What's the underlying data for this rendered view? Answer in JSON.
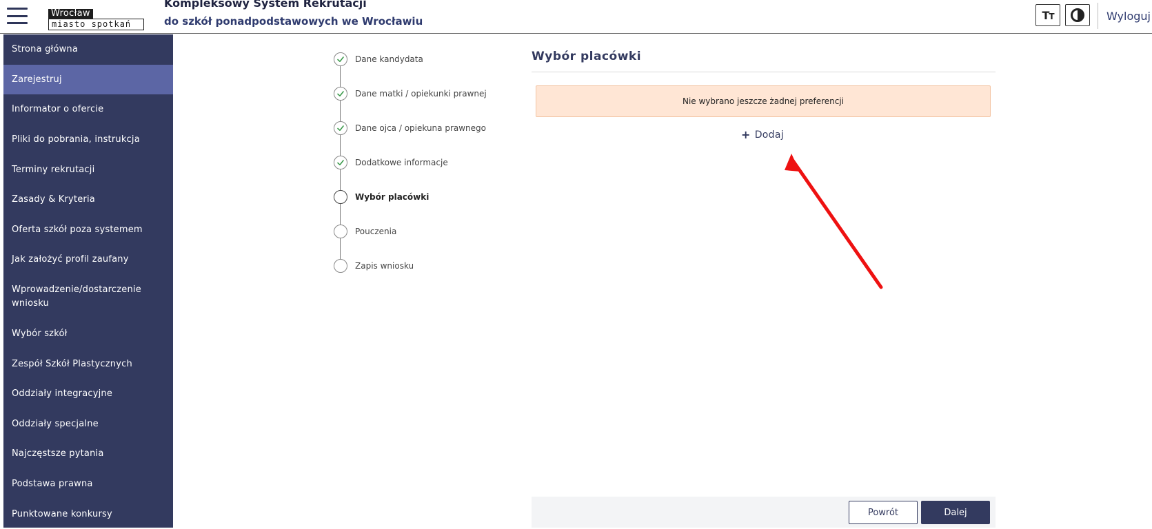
{
  "header": {
    "logo_city": "Wrocław",
    "logo_tagline": "miasto spotkań",
    "title": "Kompleksowy System Rekrutacji",
    "subtitle": "do szkół ponadpodstawowych we Wrocławiu",
    "font_size_icon": "font-size-icon",
    "contrast_icon": "contrast-icon",
    "logout_label": "Wyloguj"
  },
  "sidebar": {
    "items": [
      {
        "label": "Strona główna",
        "active": false
      },
      {
        "label": "Zarejestruj",
        "active": true
      },
      {
        "label": "Informator o ofercie",
        "active": false
      },
      {
        "label": "Pliki do pobrania, instrukcja",
        "active": false
      },
      {
        "label": "Terminy rekrutacji",
        "active": false
      },
      {
        "label": "Zasady & Kryteria",
        "active": false
      },
      {
        "label": "Oferta szkół poza systemem",
        "active": false
      },
      {
        "label": "Jak założyć profil zaufany",
        "active": false
      },
      {
        "label": "Wprowadzenie/dostarczenie wniosku",
        "active": false
      },
      {
        "label": "Wybór szkół",
        "active": false
      },
      {
        "label": "Zespół Szkół Plastycznych",
        "active": false
      },
      {
        "label": "Oddziały integracyjne",
        "active": false
      },
      {
        "label": "Oddziały specjalne",
        "active": false
      },
      {
        "label": "Najczęstsze pytania",
        "active": false
      },
      {
        "label": "Podstawa prawna",
        "active": false
      },
      {
        "label": "Punktowane konkursy",
        "active": false
      }
    ]
  },
  "stepper": {
    "steps": [
      {
        "label": "Dane kandydata",
        "status": "done"
      },
      {
        "label": "Dane matki / opiekunki prawnej",
        "status": "done"
      },
      {
        "label": "Dane ojca / opiekuna prawnego",
        "status": "done"
      },
      {
        "label": "Dodatkowe informacje",
        "status": "done"
      },
      {
        "label": "Wybór placówki",
        "status": "current"
      },
      {
        "label": "Pouczenia",
        "status": "pending"
      },
      {
        "label": "Zapis wniosku",
        "status": "pending"
      }
    ]
  },
  "main": {
    "title": "Wybór placówki",
    "alert_text": "Nie wybrano jeszcze żadnej preferencji",
    "add_label": "Dodaj"
  },
  "actions": {
    "back_label": "Powrót",
    "next_label": "Dalej"
  },
  "colors": {
    "sidebar_bg": "#333a5f",
    "sidebar_active": "#5c66a5",
    "alert_bg": "#ffe6d5",
    "step_done": "#3a9a4a",
    "annotation_arrow": "#ee1111"
  }
}
